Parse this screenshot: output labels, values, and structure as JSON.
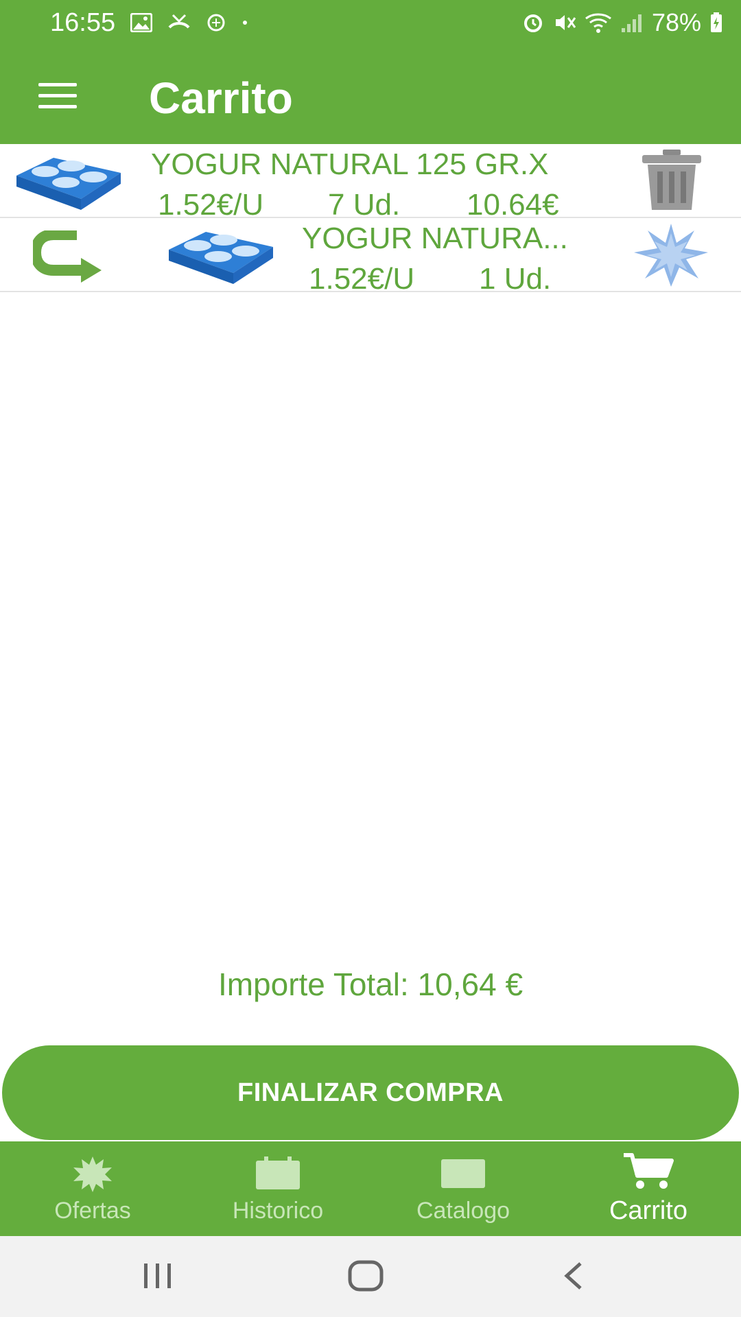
{
  "status_bar": {
    "time": "16:55",
    "battery": "78%"
  },
  "app_bar": {
    "title": "Carrito"
  },
  "cart_items": [
    {
      "name": "YOGUR NATURAL 125 GR.X",
      "unit_price": "1.52€/U",
      "quantity": "7 Ud.",
      "subtotal": "10.64€"
    },
    {
      "name": "YOGUR NATURA...",
      "unit_price": "1.52€/U",
      "quantity": "1 Ud."
    }
  ],
  "total": {
    "label": "Importe Total: 10,64 €"
  },
  "checkout": {
    "label": "FINALIZAR COMPRA"
  },
  "bottom_nav": {
    "items": [
      {
        "label": "Ofertas",
        "icon": "starburst-icon"
      },
      {
        "label": "Historico",
        "icon": "calendar-icon"
      },
      {
        "label": "Catalogo",
        "icon": "catalog-icon"
      },
      {
        "label": "Carrito",
        "icon": "cart-icon"
      }
    ],
    "active": "Carrito"
  },
  "colors": {
    "brand_green": "#64ad3d",
    "text_green": "#5fa63d",
    "inactive_nav": "#c8e6b8"
  }
}
